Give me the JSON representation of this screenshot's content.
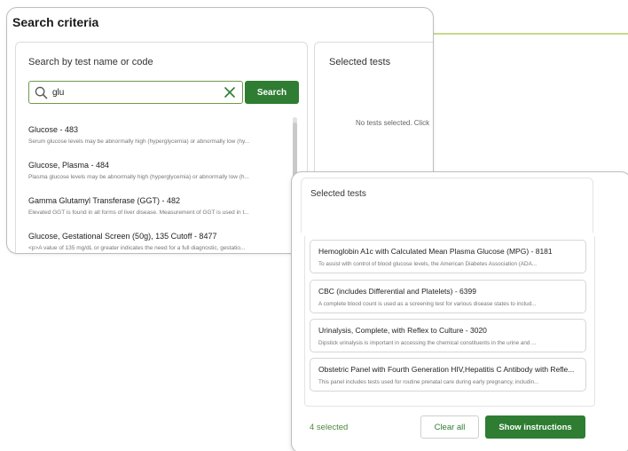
{
  "colors": {
    "accent_green": "#2e7d32",
    "connector_line": "#c5d98a",
    "connector_dot": "#8dc63f",
    "count_text": "#4c8a3a"
  },
  "search_card": {
    "title": "Search criteria",
    "search_panel": {
      "heading": "Search by test name or code",
      "input_value": "glu",
      "search_icon": "search-icon",
      "clear_icon": "close-icon",
      "search_button": "Search"
    },
    "results": [
      {
        "name": "Glucose - 483",
        "description": "Serum glucose levels may be abnormally high (hyperglycemia) or abnormally low (hy..."
      },
      {
        "name": "Glucose, Plasma - 484",
        "description": "Plasma glucose levels may be abnormally high (hyperglycemia) or abnormally low (h..."
      },
      {
        "name": "Gamma Glutamyl Transferase (GGT) - 482",
        "description": "Elevated GGT is found in all forms of liver disease. Measurement of GGT is used in t..."
      },
      {
        "name": "Glucose, Gestational Screen (50g), 135 Cutoff - 8477",
        "description": "<p>A value of 135 mg/dL or greater indicates the need for a full diagnostic, gestatio..."
      }
    ],
    "selected_panel": {
      "heading": "Selected tests",
      "empty_message": "No tests selected. Click"
    }
  },
  "selected_card": {
    "heading": "Selected tests",
    "items": [
      {
        "name": "Hemoglobin A1c with Calculated Mean Plasma Glucose (MPG) - 8181",
        "description": "To assist with control of blood glucose levels, the American Diabetes Association (ADA..."
      },
      {
        "name": "CBC (includes Differential and Platelets) - 6399",
        "description": "A complete blood count is used as a screening test for various disease states to includ..."
      },
      {
        "name": "Urinalysis, Complete, with Reflex to Culture - 3020",
        "description": "Dipstick urinalysis is important in accessing the chemical constituents in the urine and ..."
      },
      {
        "name": "Obstetric Panel with Fourth Generation HIV,Hepatitis C Antibody with Refle...",
        "description": "This panel includes tests used for routine prenatal care during early pregnancy, includin..."
      }
    ],
    "selected_count": "4 selected",
    "clear_button": "Clear all",
    "instructions_button": "Show instructions"
  }
}
